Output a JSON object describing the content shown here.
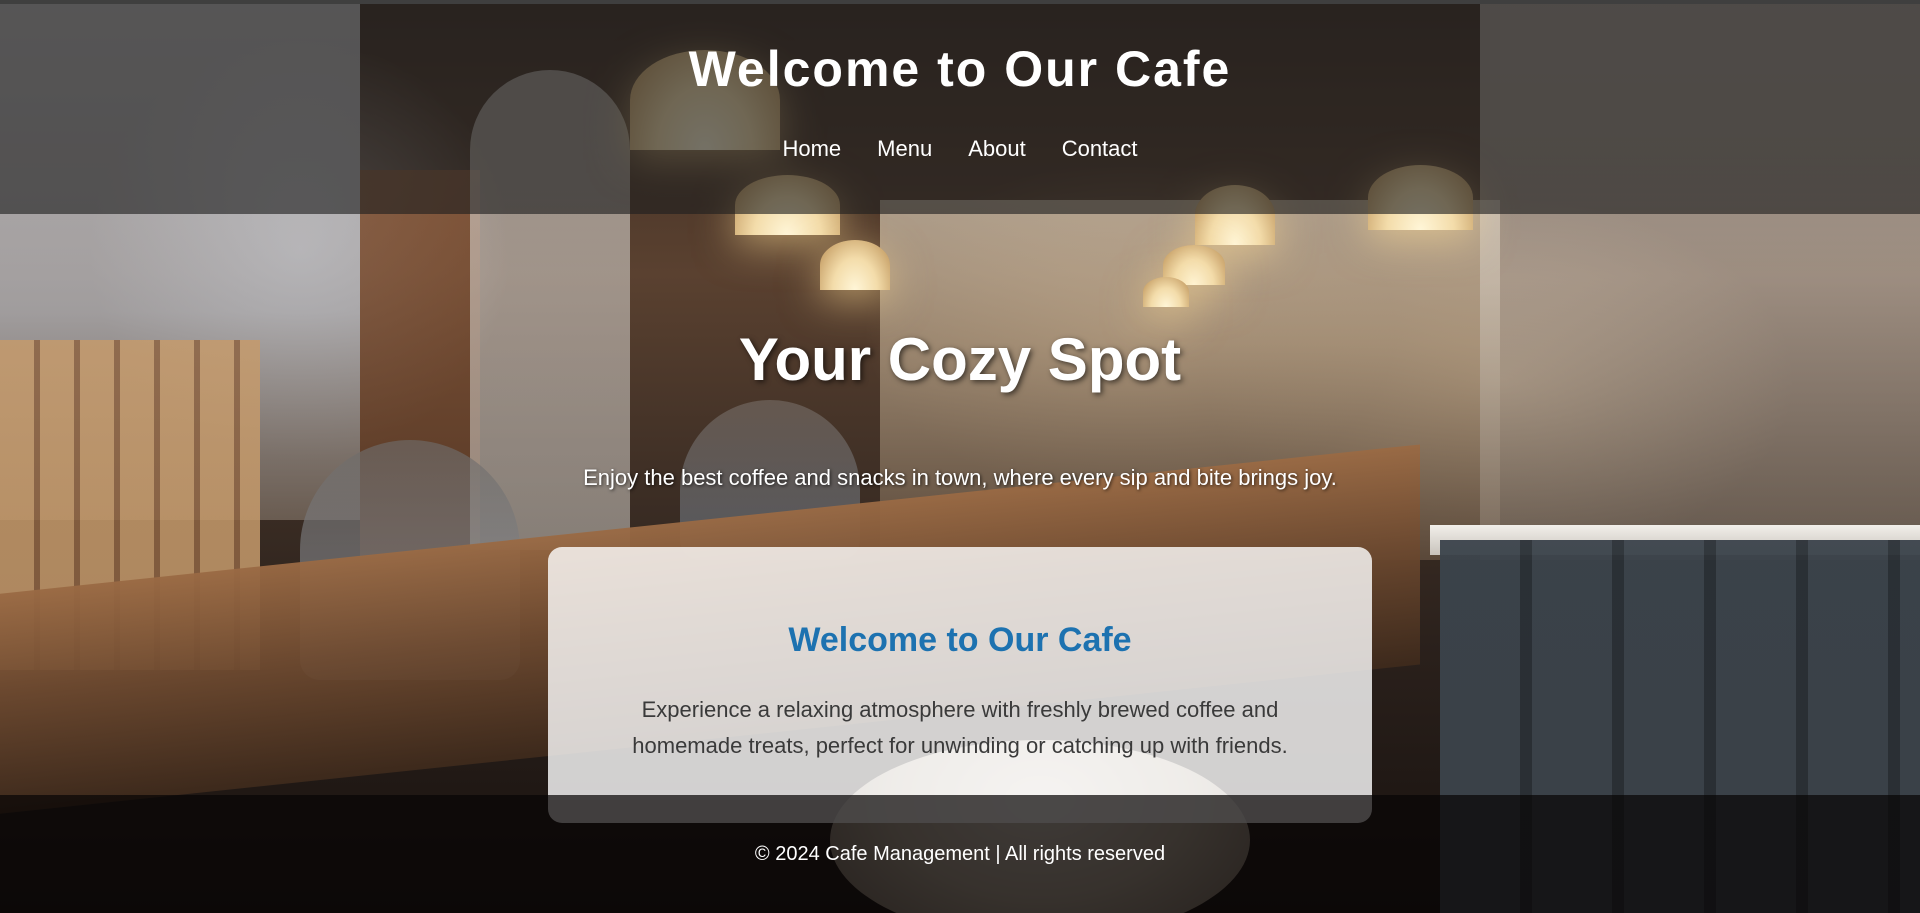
{
  "header": {
    "title": "Welcome to Our Cafe",
    "nav": [
      "Home",
      "Menu",
      "About",
      "Contact"
    ]
  },
  "hero": {
    "title": "Your Cozy Spot",
    "text": "Enjoy the best coffee and snacks in town, where every sip and bite brings joy."
  },
  "card": {
    "title": "Welcome to Our Cafe",
    "text": "Experience a relaxing atmosphere with freshly brewed coffee and homemade treats, perfect for unwinding or catching up with friends."
  },
  "footer": {
    "text": "© 2024 Cafe Management | All rights reserved"
  },
  "colors": {
    "card_title": "#1d72b0",
    "header_overlay": "#1e1e1e",
    "text_light": "#ffffff"
  }
}
